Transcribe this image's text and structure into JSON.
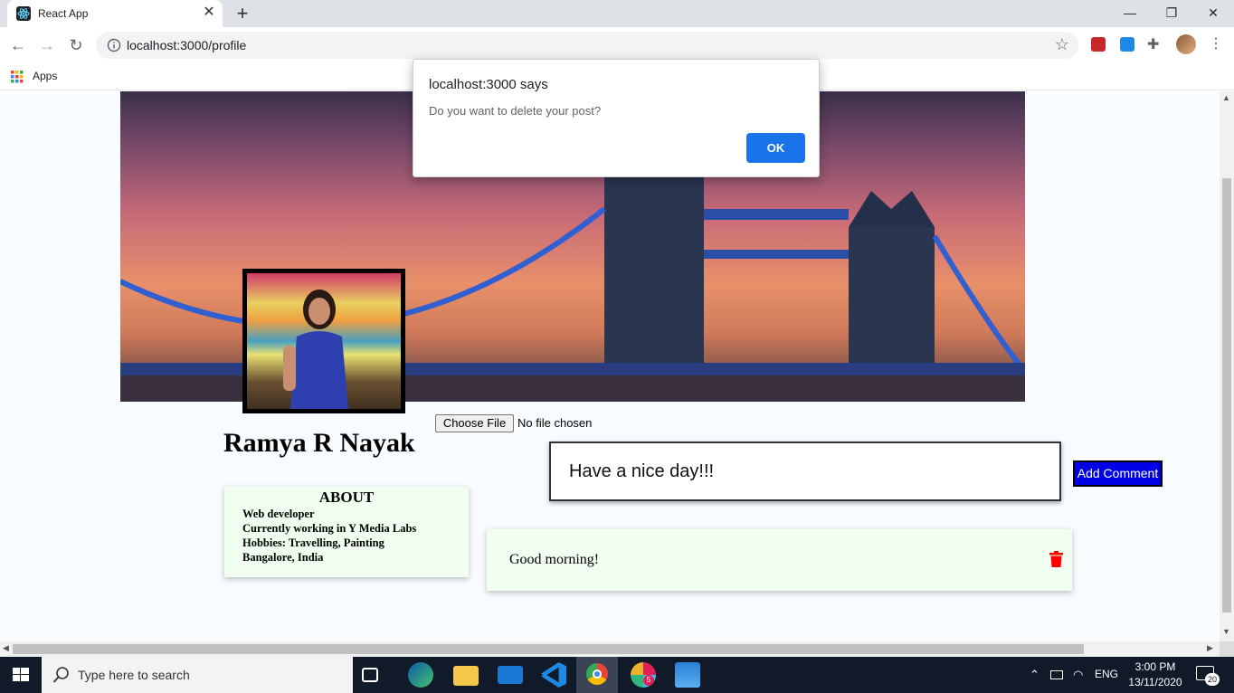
{
  "browser": {
    "tab_title": "React App",
    "url": "localhost:3000/profile",
    "bookmarks_apps": "Apps"
  },
  "dialog": {
    "title": "localhost:3000 says",
    "message": "Do you want to delete your post?",
    "ok_label": "OK"
  },
  "profile": {
    "name": "Ramya R Nayak",
    "file_button": "Choose File",
    "file_status": "No file chosen",
    "about": {
      "title": "ABOUT",
      "lines": [
        "Web developer",
        "Currently working in Y Media Labs",
        "Hobbies: Travelling, Painting",
        "Bangalore, India"
      ]
    },
    "comment_value": "Have a nice day!!!",
    "add_comment_label": "Add Comment",
    "posts": [
      {
        "text": "Good morning!"
      }
    ]
  },
  "taskbar": {
    "search_placeholder": "Type here to search",
    "language": "ENG",
    "time": "3:00 PM",
    "date": "13/11/2020",
    "notification_count": "20",
    "slack_badge": "5"
  },
  "colors": {
    "add_comment_bg": "#0000e6",
    "card_bg": "#f0fff0",
    "trash": "#ff0000",
    "ok_button": "#1a73e8"
  }
}
